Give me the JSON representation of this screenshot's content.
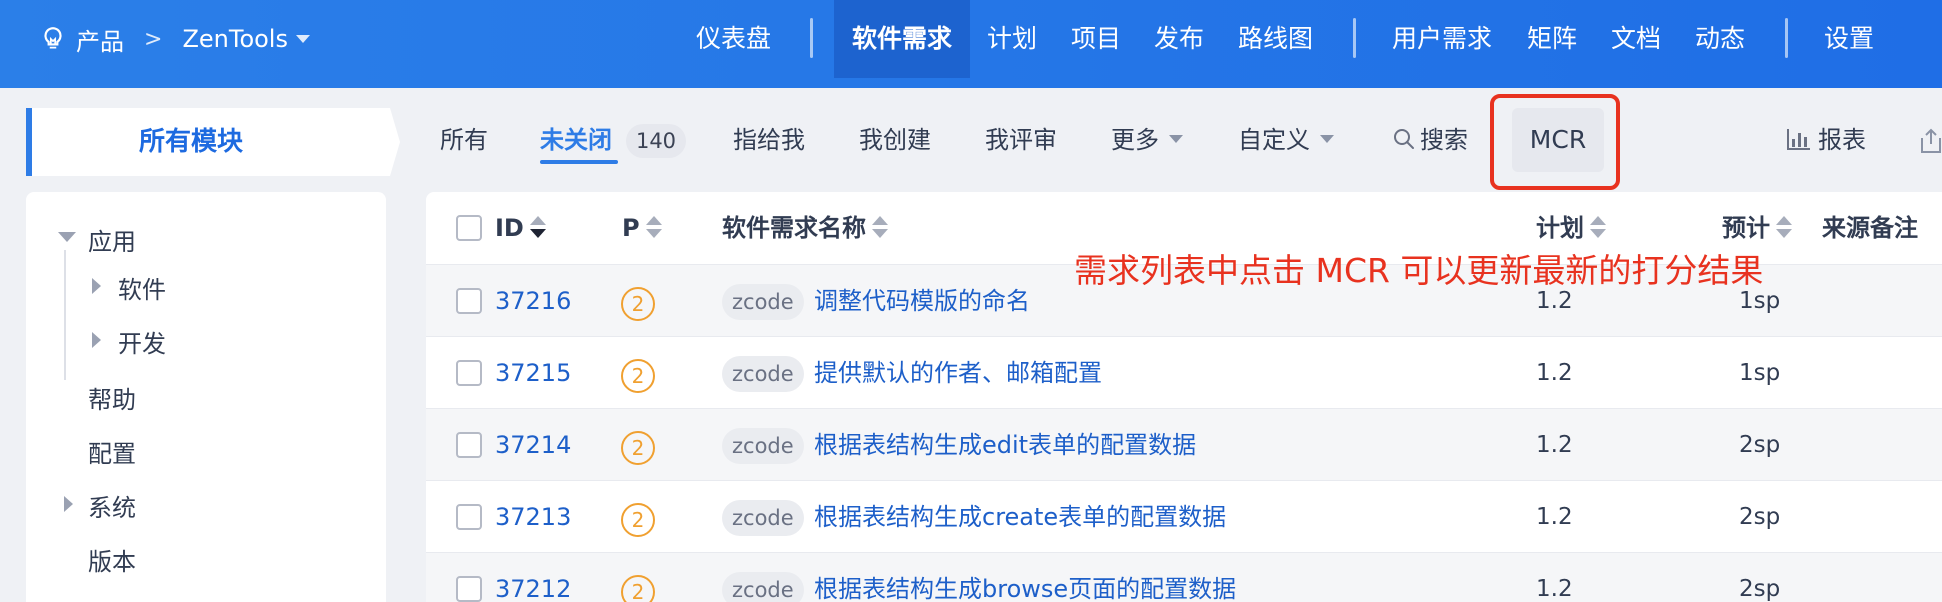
{
  "topbar": {
    "product_label": "产品",
    "separator": ">",
    "product_name": "ZenTools",
    "nav": [
      "仪表盘",
      "软件需求",
      "计划",
      "项目",
      "发布",
      "路线图",
      "用户需求",
      "矩阵",
      "文档",
      "动态",
      "设置"
    ],
    "active_nav": "软件需求"
  },
  "module_tab": {
    "label": "所有模块"
  },
  "subnav": {
    "all": "所有",
    "unclosed": "未关闭",
    "unclosed_count": "140",
    "assigned_to_me": "指给我",
    "created_by_me": "我创建",
    "reviewed_by_me": "我评审",
    "more": "更多",
    "custom": "自定义",
    "search": "搜索",
    "mcr": "MCR",
    "report": "报表"
  },
  "tree": {
    "app": "应用",
    "software": "软件",
    "dev": "开发",
    "help": "帮助",
    "config": "配置",
    "system": "系统",
    "version": "版本"
  },
  "table": {
    "columns": {
      "id": "ID",
      "priority": "P",
      "name": "软件需求名称",
      "plan": "计划",
      "estimate": "预计",
      "source_note": "来源备注"
    },
    "rows": [
      {
        "id": "37216",
        "priority": "2",
        "tag": "zcode",
        "title": "调整代码模版的命名",
        "plan": "1.2",
        "estimate": "1sp"
      },
      {
        "id": "37215",
        "priority": "2",
        "tag": "zcode",
        "title": "提供默认的作者、邮箱配置",
        "plan": "1.2",
        "estimate": "1sp"
      },
      {
        "id": "37214",
        "priority": "2",
        "tag": "zcode",
        "title": "根据表结构生成edit表单的配置数据",
        "plan": "1.2",
        "estimate": "2sp"
      },
      {
        "id": "37213",
        "priority": "2",
        "tag": "zcode",
        "title": "根据表结构生成create表单的配置数据",
        "plan": "1.2",
        "estimate": "2sp"
      },
      {
        "id": "37212",
        "priority": "2",
        "tag": "zcode",
        "title": "根据表结构生成browse页面的配置数据",
        "plan": "1.2",
        "estimate": "2sp"
      }
    ]
  },
  "annotation": "需求列表中点击 MCR 可以更新最新的打分结果",
  "colors": {
    "primary": "#2e7ce6",
    "annotation": "#e8321f",
    "priority": "#f0a030"
  }
}
